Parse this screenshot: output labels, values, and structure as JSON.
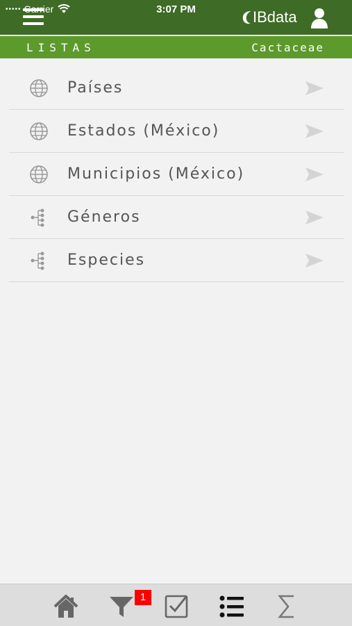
{
  "status": {
    "carrier": "Carrier",
    "time": "3:07 PM"
  },
  "header": {
    "logo_text": "IBdata",
    "section": "LISTAS",
    "context": "Cactaceae"
  },
  "list": {
    "items": [
      {
        "label": "Países",
        "icon": "globe-icon"
      },
      {
        "label": "Estados (México)",
        "icon": "globe-icon"
      },
      {
        "label": "Municipios (México)",
        "icon": "globe-icon"
      },
      {
        "label": "Géneros",
        "icon": "hierarchy-icon"
      },
      {
        "label": "Especies",
        "icon": "hierarchy-icon"
      }
    ]
  },
  "tabbar": {
    "filter_badge": "1",
    "tabs": [
      "home-icon",
      "filter-icon",
      "checkbox-icon",
      "list-icon",
      "sigma-icon"
    ]
  },
  "colors": {
    "topbar": "#3e6b26",
    "subbar": "#5c9a2c",
    "badge": "#ff0000"
  }
}
